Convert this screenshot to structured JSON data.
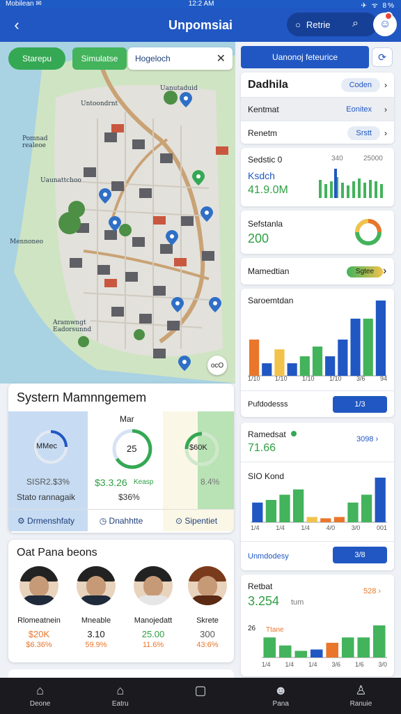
{
  "status": {
    "carrier": "Mobilean ✉",
    "time": "12:2 AM",
    "right": "✈ ᯤ 8%"
  },
  "header": {
    "title": "Unpomsiai",
    "pill_label": "Retrie",
    "back_icon": "back-arrow-icon"
  },
  "map": {
    "btn_left": "Starepu",
    "btn_mid": "Simulatse",
    "search_value": "Hogeloch",
    "labels": [
      "Uanutaduid",
      "Untoondrnt",
      "Pomnad\nrealeoe",
      "Uaunattchoo",
      "Mennoneo",
      "Aramwngt\nEadorsunnd"
    ],
    "pin_badge": "ocO"
  },
  "system": {
    "title": "Systern Mamnngemem",
    "col_b_label": "Mar",
    "gauge_a": "MMec",
    "gauge_b": "25",
    "gauge_c": "$60K",
    "val_a": "SISR2.$3%",
    "val_b": "$3.3.26",
    "val_b2": "Keasp",
    "val_c": "8.4%",
    "sub_a": "Stato rannagaik",
    "sub_b": "$36%",
    "foot": [
      "Drmenshfaty",
      "Dnahhtte",
      "Sipentiet"
    ]
  },
  "people": {
    "title": "Oat Pana beons",
    "items": [
      {
        "name": "Rlomeatnein",
        "v1": "$20K",
        "v2": "$6.36%",
        "c": "#e9762b"
      },
      {
        "name": "Mneable",
        "v1": "3.10",
        "v2": "59.9%",
        "c": "#333333"
      },
      {
        "name": "Manojedatt",
        "v1": "25.00",
        "v2": "11.6%",
        "c": "#2ea043"
      },
      {
        "name": "Skrete",
        "v1": "300",
        "v2": "43:6%",
        "c": "#333333"
      }
    ]
  },
  "right": {
    "top_btn": "Uanonoj feteurice",
    "d_title": "Dadhila",
    "d_pill": "Coden",
    "r2": {
      "label": "Kentmat",
      "pill": "Eonitex"
    },
    "r3": {
      "label": "Renetm",
      "pill": "Srstt"
    },
    "sales": {
      "label": "Sedstic 0",
      "v": "Ksdch",
      "big": "41.9.0M",
      "a": "340",
      "b": "25000"
    },
    "safety": {
      "label": "Sefstanla",
      "v": "200"
    },
    "main": {
      "label": "Mamedtian",
      "pill": "Sgtee"
    },
    "bar": {
      "label": "Saroemtdan",
      "ticks": [
        "1/10",
        "1/10",
        "1/10",
        "1/10",
        "3/6",
        "94"
      ],
      "footer": "Pufdodesss",
      "btn": "1/3"
    },
    "bar_chart": {
      "type": "bar",
      "values": [
        52,
        18,
        38,
        18,
        28,
        42,
        28,
        52,
        82,
        82,
        108
      ],
      "colors": [
        "#e9762b",
        "#2157c2",
        "#f2c24b",
        "#2157c2",
        "#43b35c",
        "#43b35c",
        "#2157c2",
        "#2157c2",
        "#2157c2",
        "#43b35c",
        "#2157c2"
      ]
    },
    "card2": {
      "label": "Ramedsat",
      "v": "71.66",
      "link": "3098",
      "sub": "SIO Kond",
      "ticks": [
        "1/4",
        "1/4",
        "1/4",
        "4/0",
        "3/0",
        "001"
      ],
      "footer": "Unmdodesy",
      "btn": "3/8"
    },
    "bar_chart2": {
      "type": "bar",
      "values": [
        30,
        34,
        42,
        50,
        8,
        6,
        8,
        30,
        42,
        68
      ],
      "colors": [
        "#2157c2",
        "#43b35c",
        "#43b35c",
        "#43b35c",
        "#f2c24b",
        "#e9762b",
        "#e9762b",
        "#43b35c",
        "#43b35c",
        "#2157c2"
      ]
    },
    "card3": {
      "label": "Retbat",
      "v": "3.254",
      "unit": "tum",
      "link": "528",
      "tick_label": "26",
      "legend": "Ttane",
      "ticks": [
        "1/4",
        "1/4",
        "1/4",
        "3/6",
        "1/6",
        "3/0"
      ]
    },
    "bar_chart3": {
      "type": "bar",
      "values": [
        30,
        18,
        10,
        12,
        22,
        30,
        30,
        48
      ],
      "colors": [
        "#43b35c",
        "#43b35c",
        "#43b35c",
        "#2157c2",
        "#e9762b",
        "#43b35c",
        "#43b35c",
        "#43b35c"
      ]
    }
  },
  "nav": [
    "Deone",
    "Eatru",
    "",
    "Pana",
    "Ranuie"
  ]
}
